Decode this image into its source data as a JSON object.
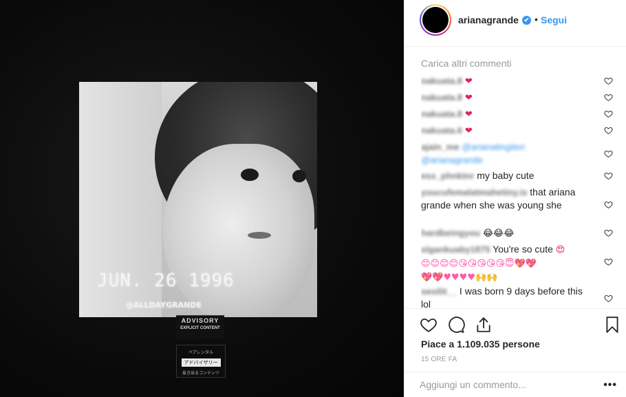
{
  "media": {
    "stamp": "JUN. 26 1996",
    "watermark": "@ALLDAYGRANDE",
    "advisory_line1": "ADVISORY",
    "advisory_line2": "EXPLICIT CONTENT",
    "jp_line1": "ペアレンタル",
    "jp_line2": "アドバイザリー",
    "jp_line3": "抜き出るコンテンツ"
  },
  "header": {
    "username": "arianagrande",
    "verified_icon": "✔",
    "separator": "•",
    "follow_label": "Segui"
  },
  "comments": {
    "load_more": "Carica altri commenti",
    "items": [
      {
        "user": "nakuata.8",
        "text": "",
        "emoji": "❤"
      },
      {
        "user": "nakuata.8",
        "text": "",
        "emoji": "❤"
      },
      {
        "user": "nakuata.8",
        "text": "",
        "emoji": "❤"
      },
      {
        "user": "nakuata.6",
        "text": "",
        "emoji": "❤"
      },
      {
        "user": "ajain_me",
        "mention": "@arianatingiteri",
        "mention2": "@arianagrande",
        "text": ""
      },
      {
        "user": "esx_phnktnr",
        "text": "my baby cute"
      },
      {
        "user": "youcufemalatmahetiny.is",
        "text": "that ariana grande when she was young she"
      },
      {
        "user": "hardbeingyou",
        "text": "",
        "emoji": "😂😂😂"
      },
      {
        "user": "slgankuaby1875",
        "text": "You're so cute",
        "emoji": "😍",
        "emoji2": "😊😊😊😊😘😘😘😘😘😇💖💖",
        "emoji3": "💖💖♥♥♥♥🙌🙌"
      },
      {
        "user": "seoilit__",
        "text": "I was born 9 days before this lol"
      }
    ]
  },
  "post": {
    "likes_text": "Piace a 1.109.035 persone",
    "time_text": "15 ORE FA"
  },
  "composer": {
    "placeholder": "Aggiungi un commento...",
    "more_label": "•••"
  },
  "colors": {
    "accent": "#3897f0",
    "text": "#262626",
    "muted": "#999999",
    "border": "#efefef"
  }
}
